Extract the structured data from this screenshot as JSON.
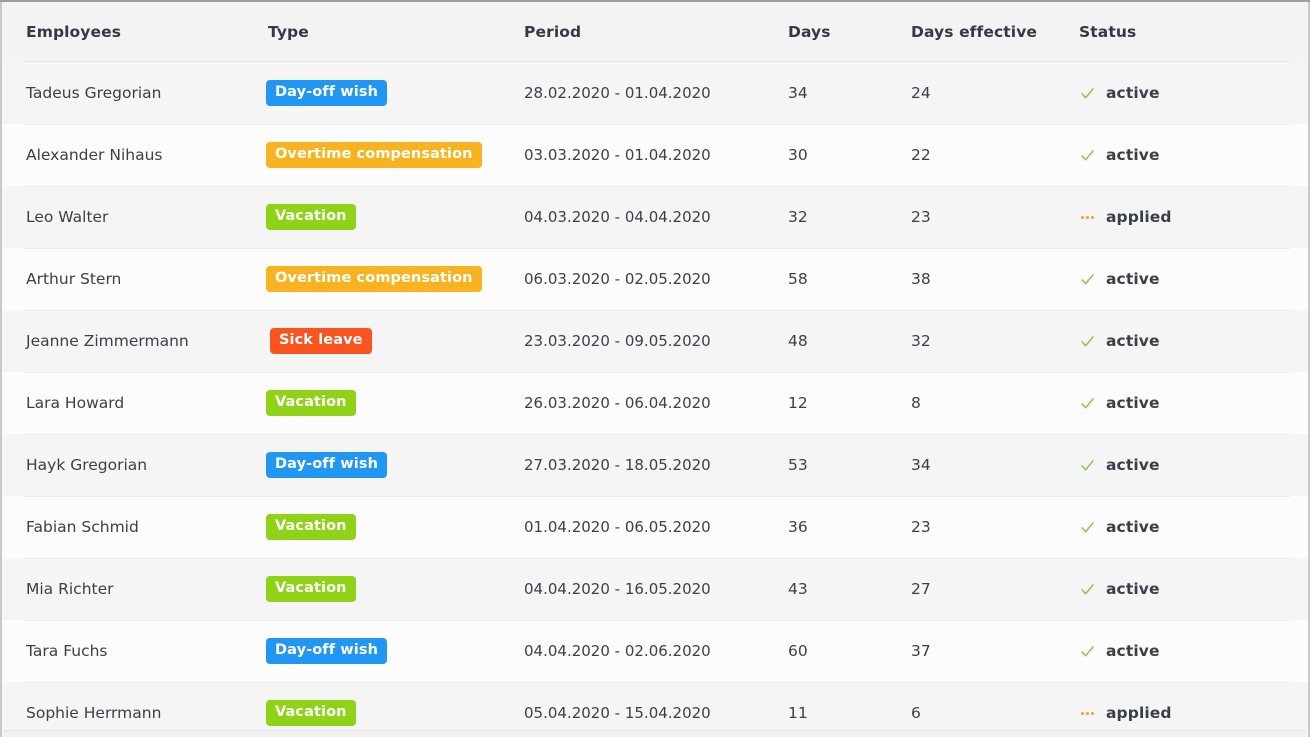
{
  "table": {
    "columns": [
      {
        "key": "employee",
        "label": "Employees"
      },
      {
        "key": "type",
        "label": "Type"
      },
      {
        "key": "period",
        "label": "Period"
      },
      {
        "key": "days",
        "label": "Days"
      },
      {
        "key": "dayseff",
        "label": "Days effective"
      },
      {
        "key": "status",
        "label": "Status"
      }
    ],
    "rows": [
      {
        "employee": "Tadeus Gregorian",
        "type": "Day-off wish",
        "type_variant": "dayoff",
        "period": "28.02.2020 - 01.04.2020",
        "days": "34",
        "days_effective": "24",
        "status": "active",
        "status_icon": "check-icon"
      },
      {
        "employee": "Alexander Nihaus",
        "type": "Overtime compensation",
        "type_variant": "overtime",
        "period": "03.03.2020 - 01.04.2020",
        "days": "30",
        "days_effective": "22",
        "status": "active",
        "status_icon": "check-icon"
      },
      {
        "employee": "Leo Walter",
        "type": "Vacation",
        "type_variant": "vacation",
        "period": "04.03.2020 - 04.04.2020",
        "days": "32",
        "days_effective": "23",
        "status": "applied",
        "status_icon": "ellipsis-icon"
      },
      {
        "employee": "Arthur Stern",
        "type": "Overtime compensation",
        "type_variant": "overtime",
        "period": "06.03.2020 - 02.05.2020",
        "days": "58",
        "days_effective": "38",
        "status": "active",
        "status_icon": "check-icon"
      },
      {
        "employee": "Jeanne Zimmermann",
        "type": "Sick leave",
        "type_variant": "sick",
        "period": "23.03.2020 - 09.05.2020",
        "days": "48",
        "days_effective": "32",
        "status": "active",
        "status_icon": "check-icon"
      },
      {
        "employee": "Lara Howard",
        "type": "Vacation",
        "type_variant": "vacation",
        "period": "26.03.2020 - 06.04.2020",
        "days": "12",
        "days_effective": "8",
        "status": "active",
        "status_icon": "check-icon"
      },
      {
        "employee": "Hayk Gregorian",
        "type": "Day-off wish",
        "type_variant": "dayoff",
        "period": "27.03.2020 - 18.05.2020",
        "days": "53",
        "days_effective": "34",
        "status": "active",
        "status_icon": "check-icon"
      },
      {
        "employee": "Fabian Schmid",
        "type": "Vacation",
        "type_variant": "vacation",
        "period": "01.04.2020 - 06.05.2020",
        "days": "36",
        "days_effective": "23",
        "status": "active",
        "status_icon": "check-icon"
      },
      {
        "employee": "Mia Richter",
        "type": "Vacation",
        "type_variant": "vacation",
        "period": "04.04.2020 - 16.05.2020",
        "days": "43",
        "days_effective": "27",
        "status": "active",
        "status_icon": "check-icon"
      },
      {
        "employee": "Tara Fuchs",
        "type": "Day-off wish",
        "type_variant": "dayoff",
        "period": "04.04.2020 - 02.06.2020",
        "days": "60",
        "days_effective": "37",
        "status": "active",
        "status_icon": "check-icon"
      },
      {
        "employee": "Sophie Herrmann",
        "type": "Vacation",
        "type_variant": "vacation",
        "period": "05.04.2020 - 15.04.2020",
        "days": "11",
        "days_effective": "6",
        "status": "applied",
        "status_icon": "ellipsis-icon"
      }
    ]
  },
  "colors": {
    "badge_dayoff": "#2196f3",
    "badge_overtime": "#f9b320",
    "badge_vacation": "#8fd216",
    "badge_sick": "#f9531f",
    "status_active": "#8bc34a",
    "status_applied": "#f5a623",
    "row_odd": "#f5f5f5",
    "row_even": "#fcfcfc",
    "header_bg": "#f3f3f3",
    "text": "#3c4049"
  }
}
